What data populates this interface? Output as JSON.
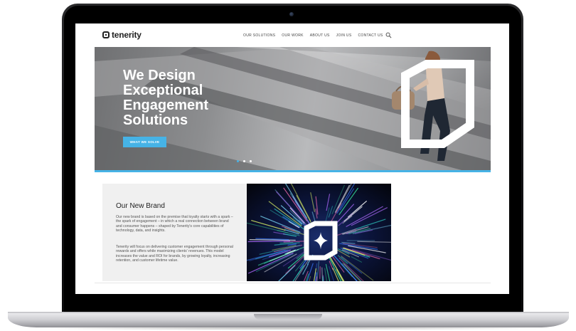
{
  "site": {
    "logo_text": "tenerity",
    "nav": [
      "OUR SOLUTIONS",
      "OUR WORK",
      "ABOUT US",
      "JOIN US",
      "CONTACT US"
    ]
  },
  "hero": {
    "title_lines": [
      "We Design",
      "Exceptional",
      "Engagement",
      "Solutions"
    ],
    "button_label": "WHAT WE SOLVE",
    "slide_count": 3,
    "active_slide": 1
  },
  "brand": {
    "title": "Our New Brand",
    "paragraph_1": "Our new brand is based on the premise that loyalty starts with a spark – the spark of engagement – in which a real connection between brand and consumer happens – shaped by Tenerity's core capabilities of technology, data, and insights.",
    "paragraph_2": "Tenerity will focus on delivering customer engagement through personal rewards and offers while maximizing clients' revenues. This model increases the value and ROI for brands, by growing loyalty, increasing retention, and customer lifetime value."
  },
  "colors": {
    "accent": "#46b3e6",
    "text_dark": "#222222",
    "brand_panel_bg": "#f0f0f0"
  },
  "icons": [
    "search-icon",
    "tenerity-logo-icon",
    "spark-logo-icon"
  ]
}
